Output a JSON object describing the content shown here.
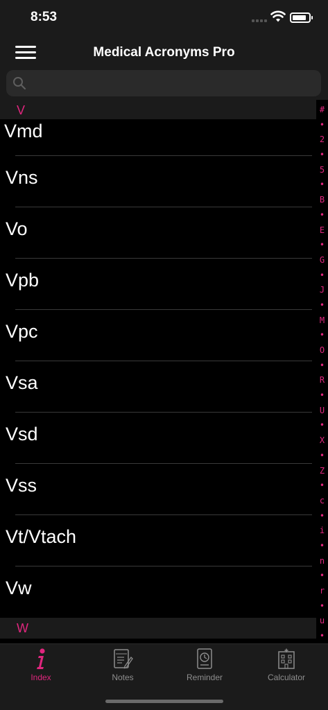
{
  "status_bar": {
    "time": "8:53"
  },
  "nav": {
    "title": "Medical Acronyms Pro"
  },
  "search": {
    "placeholder": ""
  },
  "sections": [
    {
      "letter": "V"
    },
    {
      "letter": "W"
    }
  ],
  "list": {
    "items": [
      "Vmd",
      "Vns",
      "Vo",
      "Vpb",
      "Vpc",
      "Vsa",
      "Vsd",
      "Vss",
      "Vt/Vtach",
      "Vw"
    ]
  },
  "index_strip": {
    "chars": [
      "#",
      "•",
      "2",
      "•",
      "5",
      "•",
      "B",
      "•",
      "E",
      "•",
      "G",
      "•",
      "J",
      "•",
      "M",
      "•",
      "O",
      "•",
      "R",
      "•",
      "U",
      "•",
      "X",
      "•",
      "Z",
      "•",
      "c",
      "•",
      "i",
      "•",
      "n",
      "•",
      "r",
      "•",
      "u",
      "•"
    ]
  },
  "tabs": [
    {
      "label": "Index",
      "icon": "info-icon",
      "active": true
    },
    {
      "label": "Notes",
      "icon": "notes-icon",
      "active": false
    },
    {
      "label": "Reminder",
      "icon": "clock-icon",
      "active": false
    },
    {
      "label": "Calculator",
      "icon": "hospital-icon",
      "active": false
    }
  ],
  "colors": {
    "accent": "#e0267e",
    "background": "#000000",
    "bar": "#1b1b1b"
  }
}
